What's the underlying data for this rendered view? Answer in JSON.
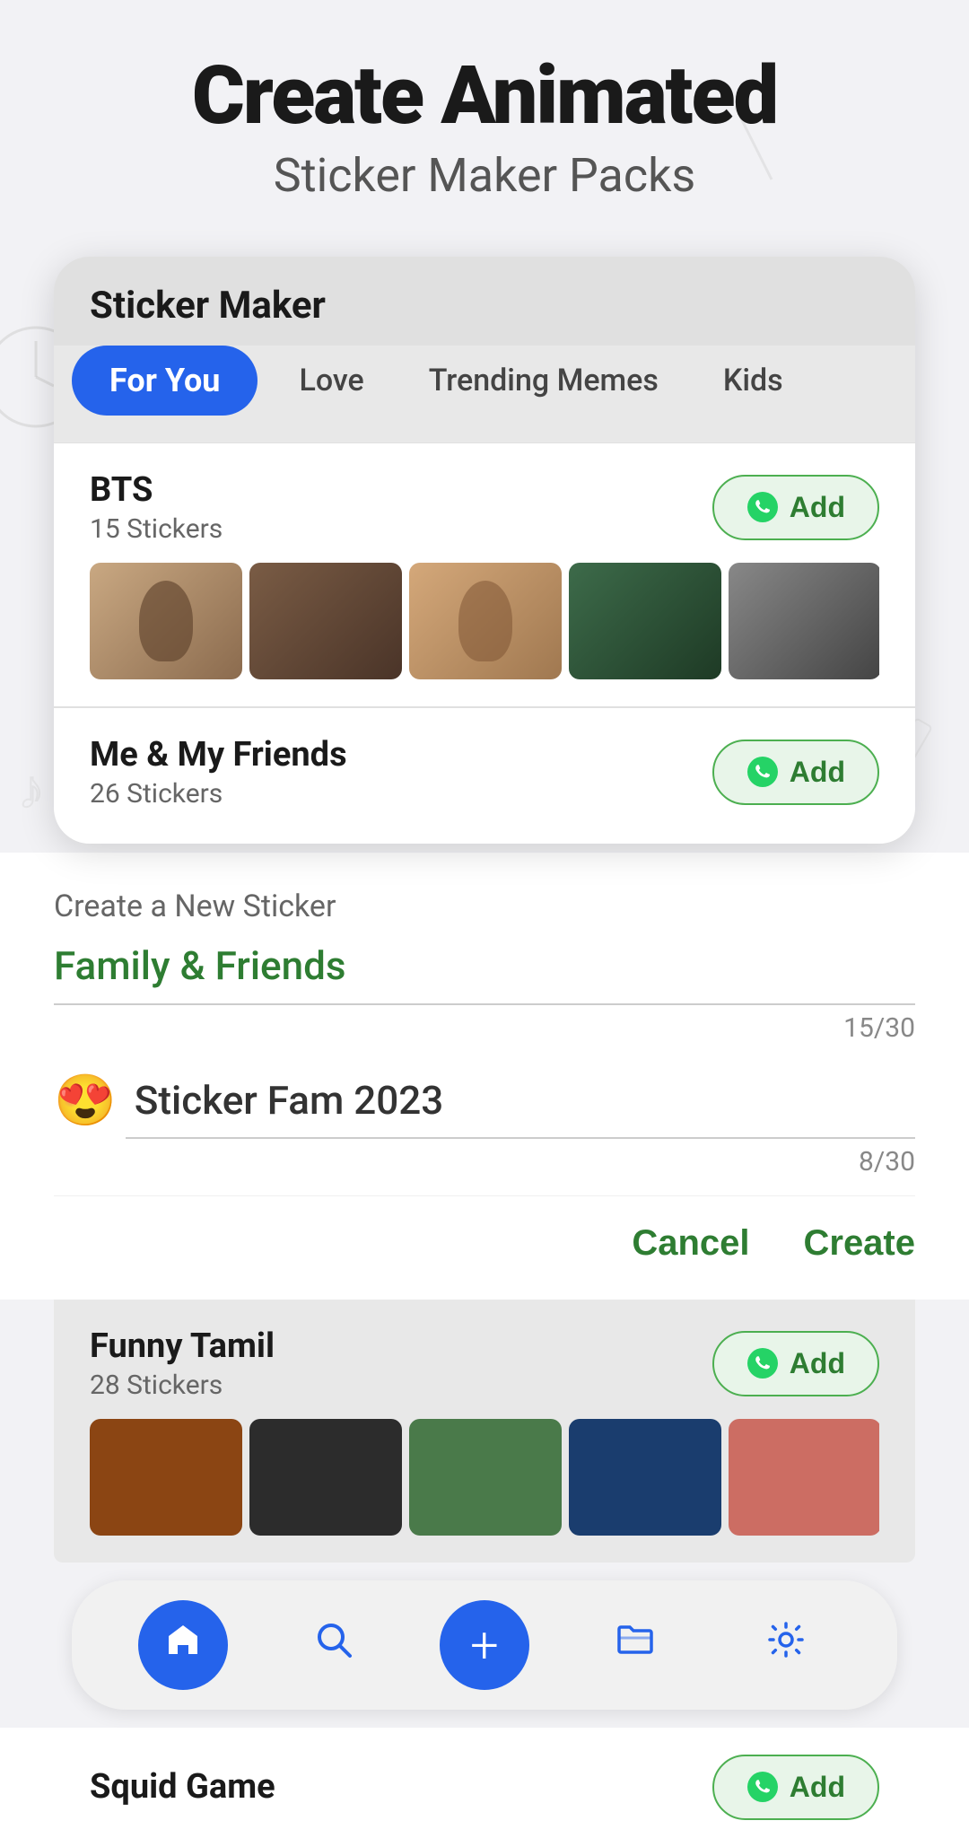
{
  "header": {
    "title": "Create Animated",
    "subtitle": "Sticker Maker Packs"
  },
  "phone_card": {
    "title": "Sticker Maker"
  },
  "tabs": {
    "items": [
      {
        "label": "For You",
        "active": true
      },
      {
        "label": "Love",
        "active": false
      },
      {
        "label": "Trending Memes",
        "active": false
      },
      {
        "label": "Kids",
        "active": false
      }
    ]
  },
  "bts_pack": {
    "name": "BTS",
    "count": "15 Stickers",
    "add_label": "Add"
  },
  "friends_pack": {
    "name": "Me & My Friends",
    "count": "26 Stickers",
    "add_label": "Add"
  },
  "create_sticker": {
    "label": "Create a New Sticker",
    "pack1_name": "Family & Friends",
    "pack1_count": "15/30",
    "pack2_emoji": "😍",
    "pack2_name": "Sticker Fam 2023",
    "pack2_count": "8/30",
    "cancel_label": "Cancel",
    "create_label": "Create"
  },
  "funny_pack": {
    "name": "Funny Tamil",
    "count": "28 Stickers",
    "add_label": "Add"
  },
  "squid_pack": {
    "name": "Squid Game",
    "add_label": "Add"
  },
  "bottom_nav": {
    "items": [
      {
        "icon": "home",
        "label": "Home",
        "active": true
      },
      {
        "icon": "search",
        "label": "Search",
        "active": false
      },
      {
        "icon": "plus",
        "label": "Add",
        "active": false
      },
      {
        "icon": "folder",
        "label": "Collection",
        "active": false
      },
      {
        "icon": "settings",
        "label": "Settings",
        "active": false
      }
    ]
  },
  "colors": {
    "accent_blue": "#2563eb",
    "accent_green": "#2e7d32",
    "whatsapp_green": "#25d366",
    "tab_active_bg": "#2563eb",
    "tab_active_text": "#ffffff"
  }
}
